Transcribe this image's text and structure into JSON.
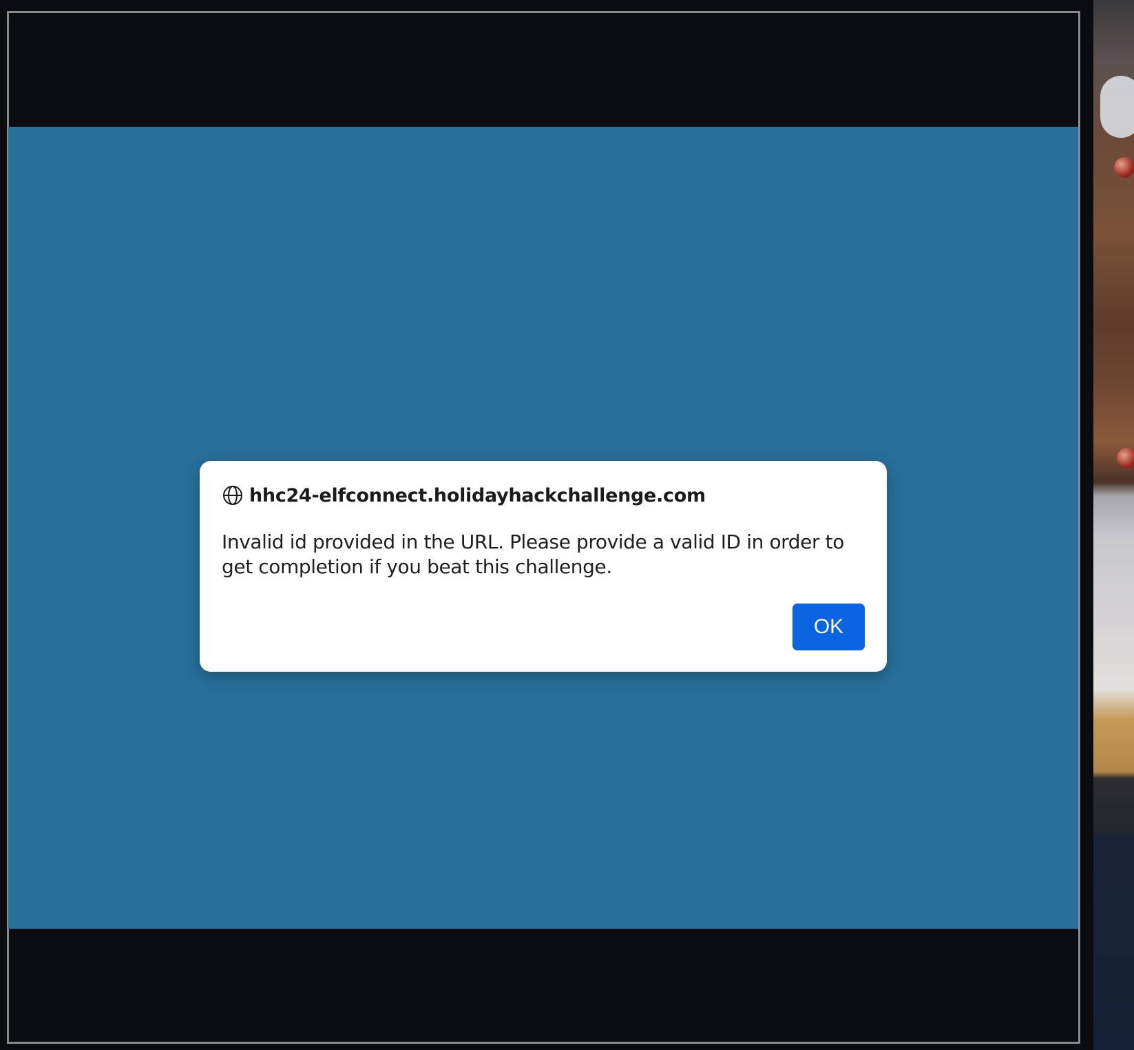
{
  "dialog": {
    "origin": "hhc24-elfconnect.holidayhackchallenge.com",
    "message": "Invalid id provided in the URL. Please provide a valid ID in order to get completion if you beat this challenge.",
    "ok_label": "OK",
    "origin_icon": "globe-icon"
  },
  "colors": {
    "page_background": "#0b0c0f",
    "game_viewport": "#286f9a",
    "dialog_background": "#ffffff",
    "ok_button": "#0a63df",
    "frame_border": "#8a8a8c"
  }
}
